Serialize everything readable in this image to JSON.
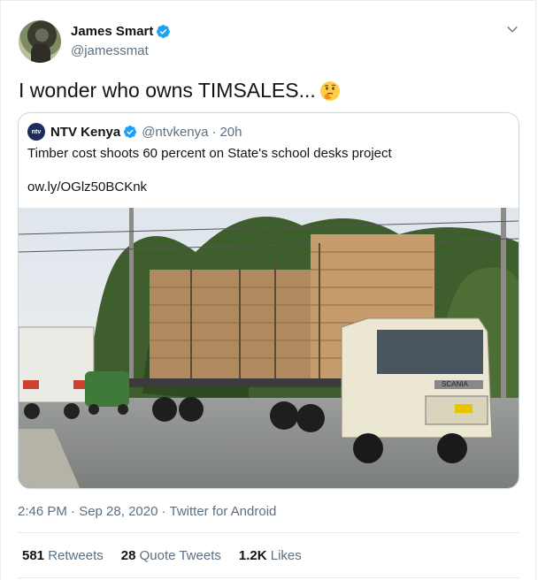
{
  "author": {
    "name": "James Smart",
    "handle": "@jamessmat"
  },
  "tweet": {
    "text": "I wonder who owns TIMSALES...",
    "emoji": "thinking-face-icon"
  },
  "quoted": {
    "logo_text": "ntv",
    "name": "NTV Kenya",
    "handle": "@ntvkenya",
    "separator": "·",
    "age": "20h",
    "text": "Timber cost shoots 60 percent on State's school desks project",
    "link": "ow.ly/OGlz50BCKnk",
    "truck_plate": "SCANIA"
  },
  "meta": {
    "time": "2:46 PM · Sep 28, 2020 · Twitter for Android"
  },
  "stats": [
    {
      "count": "581",
      "label": "Retweets"
    },
    {
      "count": "28",
      "label": "Quote Tweets"
    },
    {
      "count": "1.2K",
      "label": "Likes"
    }
  ],
  "colors": {
    "verified": "#1da1f2",
    "muted": "#5b7083"
  }
}
